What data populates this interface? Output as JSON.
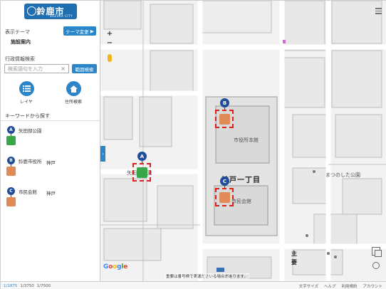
{
  "logo": {
    "text": "鈴鹿市",
    "subtext": "SUZUKA CITY"
  },
  "sidebar": {
    "theme_label": "表示テーマ",
    "theme_button": "テーマ変更",
    "theme_name": "施設案内",
    "search_label": "行政情報検索",
    "search_placeholder": "検索語句を入力",
    "range_button": "範囲検索",
    "tools": [
      {
        "label": "レイヤ",
        "icon": "list-icon"
      },
      {
        "label": "住所検索",
        "icon": "home-icon"
      }
    ],
    "keyword_label": "キーワードから探す",
    "places": [
      {
        "letter": "A",
        "name": "矢田部公園",
        "address": "",
        "color": "#3aa64a"
      },
      {
        "letter": "B",
        "name": "鈴鹿市役所",
        "address": "神戸",
        "color": "#e08a55"
      },
      {
        "letter": "C",
        "name": "市民会館",
        "address": "神戸",
        "color": "#e08a55"
      }
    ]
  },
  "map": {
    "labels": {
      "city_hall_main": "市役所本館",
      "kanbe": "神戸一丁目",
      "civic_hall": "市民会館",
      "matsunoshita": "まつのした公園",
      "park_a": "矢田部公園",
      "shu": "主",
      "yo": "要",
      "bekkan": "市役所別館"
    },
    "notice": "重要は番号検で実運ださいる場合があります。",
    "google": "Google",
    "markers": [
      {
        "letter": "A",
        "color": "#3aa64a"
      },
      {
        "letter": "B",
        "color": "#e08a55"
      },
      {
        "letter": "C",
        "color": "#e08a55"
      }
    ]
  },
  "footer": {
    "scales": [
      "1/1875",
      "1/3750",
      "1/7500"
    ],
    "links": [
      "文字サイズ",
      "ヘルプ",
      "利用規約",
      "アカウント"
    ],
    "copyright": "利用規約"
  }
}
